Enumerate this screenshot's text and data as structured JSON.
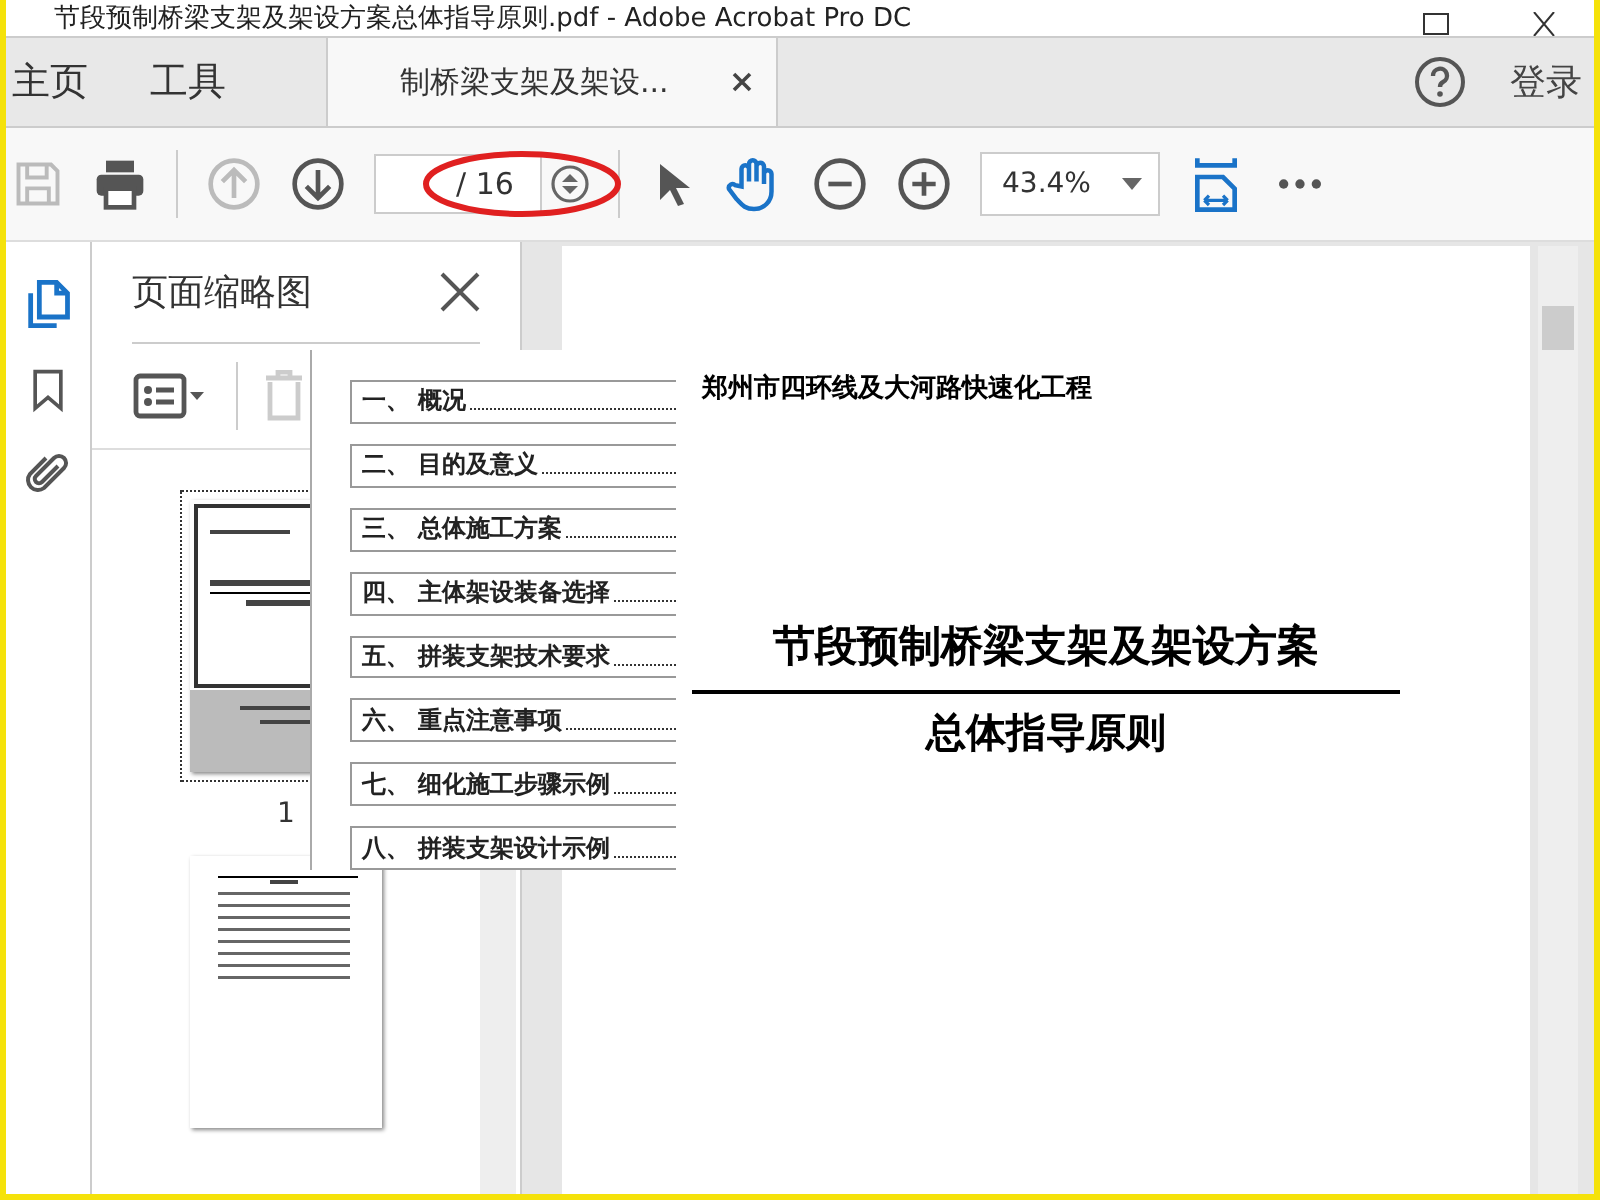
{
  "window": {
    "title": "节段预制桥梁支架及架设方案总体指导原则.pdf - Adobe Acrobat Pro DC"
  },
  "nav_tabs": [
    {
      "label": "主页",
      "selected": false
    },
    {
      "label": "工具",
      "selected": false
    }
  ],
  "document_tab": {
    "label": "制桥梁支架及架设..."
  },
  "sign_in": "登录",
  "toolbar": {
    "buttons": [
      {
        "kind": "save",
        "disabled": true
      },
      {
        "kind": "print",
        "disabled": false
      },
      {
        "kind": "sep"
      },
      {
        "kind": "prev",
        "disabled": true
      },
      {
        "kind": "next",
        "disabled": false
      },
      {
        "kind": "page"
      },
      {
        "kind": "sep"
      },
      {
        "kind": "pointer",
        "selected": false,
        "disabled": false
      },
      {
        "kind": "hand",
        "selected": true,
        "disabled": false
      },
      {
        "kind": "zoom_out",
        "disabled": false
      },
      {
        "kind": "zoom_in",
        "disabled": false
      },
      {
        "kind": "zoom"
      },
      {
        "kind": "fit",
        "disabled": false
      },
      {
        "kind": "more",
        "disabled": false
      }
    ],
    "page_total": "/ 16",
    "zoom": "43.4%"
  },
  "left_rail": [
    {
      "kind": "pages",
      "selected": true
    },
    {
      "kind": "bookmarks",
      "selected": false
    },
    {
      "kind": "attachments",
      "selected": false
    }
  ],
  "thumbnail_panel": {
    "title": "页面缩略图",
    "thumbnails": [
      {
        "kind": "cover",
        "label": "1",
        "selected": true
      },
      {
        "kind": "contents",
        "selected": false
      }
    ]
  },
  "toc_popup": [
    "一、 概况",
    "二、 目的及意义",
    "三、 总体施工方案",
    "四、 主体架设装备选择",
    "五、 拼装支架技术要求",
    "六、 重点注意事项",
    "七、 细化施工步骤示例",
    "八、 拼装支架设计示例"
  ],
  "document": {
    "header": "郑州市四环线及大河路快速化工程",
    "title": "节段预制桥梁支架及架设方案",
    "subtitle": "总体指导原则"
  }
}
